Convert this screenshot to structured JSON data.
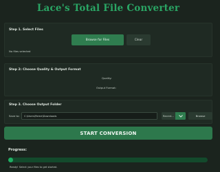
{
  "app": {
    "title": "Lace's Total File Converter"
  },
  "step1": {
    "title": "Step 1. Select Files",
    "browse_label": "Browse for Files",
    "clear_label": "Clear",
    "status": "No files selected"
  },
  "step2": {
    "title": "Step 2: Choose Quality & Output Format",
    "quality_label": "Quality:",
    "format_label": "Output Format:"
  },
  "step3": {
    "title": "Step 3. Choose Output Folder",
    "save_label": "Save to:",
    "path_value": "C:\\Users\\Reme\\Downloads",
    "preset_value": "Recent...",
    "browse_label": "Browse"
  },
  "action": {
    "start_label": "START CONVERSION"
  },
  "progress": {
    "label": "Progress:",
    "value": 0,
    "status": "Ready! Select your files to get started."
  },
  "colors": {
    "accent": "#2aa564",
    "button": "#2f7d4f",
    "background": "#1b241e"
  }
}
